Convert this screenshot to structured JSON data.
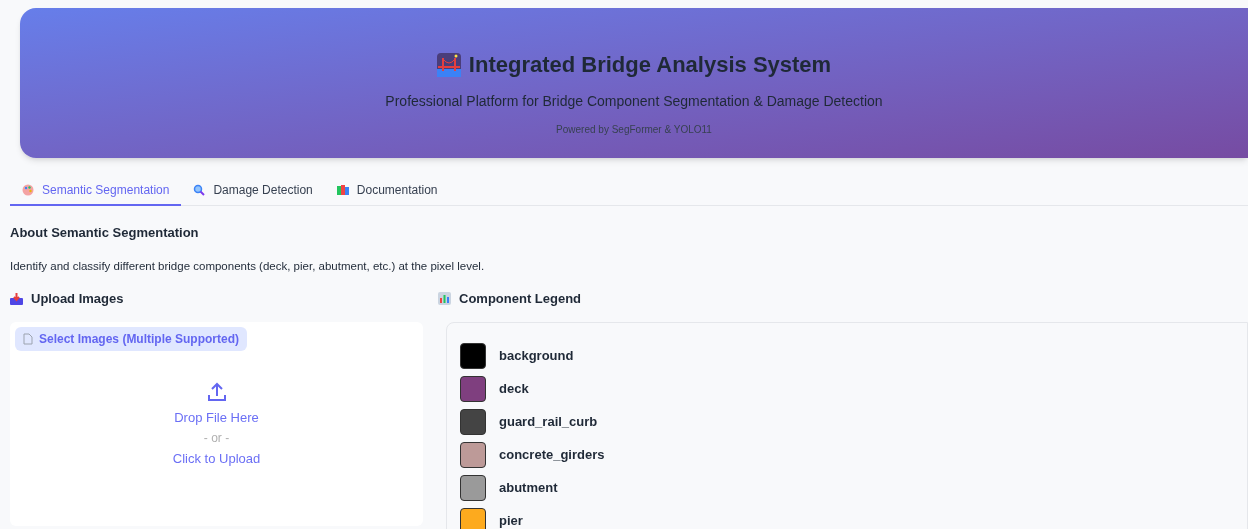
{
  "header": {
    "title": "Integrated Bridge Analysis System",
    "subtitle": "Professional Platform for Bridge Component Segmentation & Damage Detection",
    "powered_by": "Powered by SegFormer & YOLO11"
  },
  "tabs": [
    {
      "label": "Semantic Segmentation",
      "kind": "palette",
      "selected": true
    },
    {
      "label": "Damage Detection",
      "kind": "magnifier",
      "selected": false
    },
    {
      "label": "Documentation",
      "kind": "books",
      "selected": false
    }
  ],
  "about": {
    "heading": "About Semantic Segmentation",
    "text": "Identify and classify different bridge components (deck, pier, abutment, etc.) at the pixel level."
  },
  "upload": {
    "heading": "Upload Images",
    "button": "Select Images (Multiple Supported)",
    "drop_text": "Drop File Here",
    "or_text": "- or -",
    "click_text": "Click to Upload"
  },
  "legend": {
    "heading": "Component Legend",
    "items": [
      {
        "name": "background",
        "color": "#000000"
      },
      {
        "name": "deck",
        "color": "#7f3f7f"
      },
      {
        "name": "guard_rail_curb",
        "color": "#444444"
      },
      {
        "name": "concrete_girders",
        "color": "#bd9a98"
      },
      {
        "name": "abutment",
        "color": "#9a9a9a"
      },
      {
        "name": "pier",
        "color": "#fdaa1e"
      }
    ]
  }
}
